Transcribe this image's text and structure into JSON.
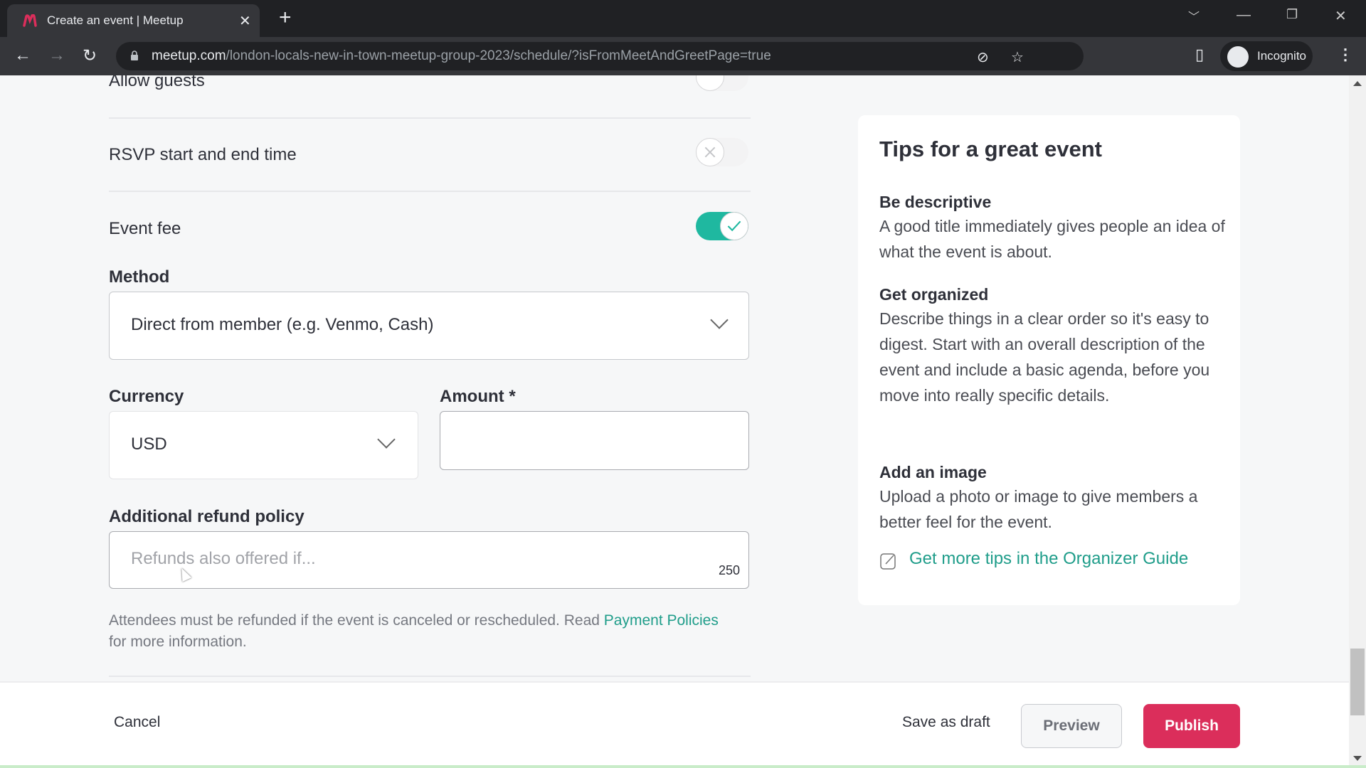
{
  "browser": {
    "tab_title": "Create an event | Meetup",
    "favicon": "meetup-logo-icon",
    "url_host": "meetup.com",
    "url_path": "/london-locals-new-in-town-meetup-group-2023/schedule/?isFromMeetAndGreetPage=true",
    "profile_label": "Incognito",
    "brand_color": "#db2e5b"
  },
  "settings": {
    "allow_guests": {
      "label": "Allow guests",
      "enabled": false
    },
    "rsvp_time": {
      "label": "RSVP start and end time",
      "enabled": false
    },
    "event_fee": {
      "label": "Event fee",
      "enabled": true
    }
  },
  "fee": {
    "method_label": "Method",
    "method_value": "Direct from member (e.g. Venmo, Cash)",
    "currency_label": "Currency",
    "currency_value": "USD",
    "amount_label": "Amount *",
    "amount_value": "",
    "refund_label": "Additional refund policy",
    "refund_placeholder": "Refunds also offered if...",
    "refund_counter": "250",
    "helper_text": "Attendees must be refunded if the event is canceled or rescheduled. Read ",
    "helper_link": "Payment Policies",
    "helper_suffix": " for more information."
  },
  "tips": {
    "title": "Tips for a great event",
    "items": [
      {
        "title": "Be descriptive",
        "body": "A good title immediately gives people an idea of what the event is about."
      },
      {
        "title": "Get organized",
        "body": "Describe things in a clear order so it's easy to digest. Start with an overall description of the event and include a basic agenda, before you move into really specific details."
      },
      {
        "title": "Add an image",
        "body": "Upload a photo or image to give members a better feel for the event."
      }
    ],
    "guide_link": "Get more tips in the Organizer Guide"
  },
  "footer": {
    "cancel": "Cancel",
    "save_draft": "Save as draft",
    "preview": "Preview",
    "publish": "Publish"
  },
  "colors": {
    "accent_teal": "#1fb8a0",
    "link_teal": "#1f9d8a",
    "publish_red": "#db2e5b"
  }
}
